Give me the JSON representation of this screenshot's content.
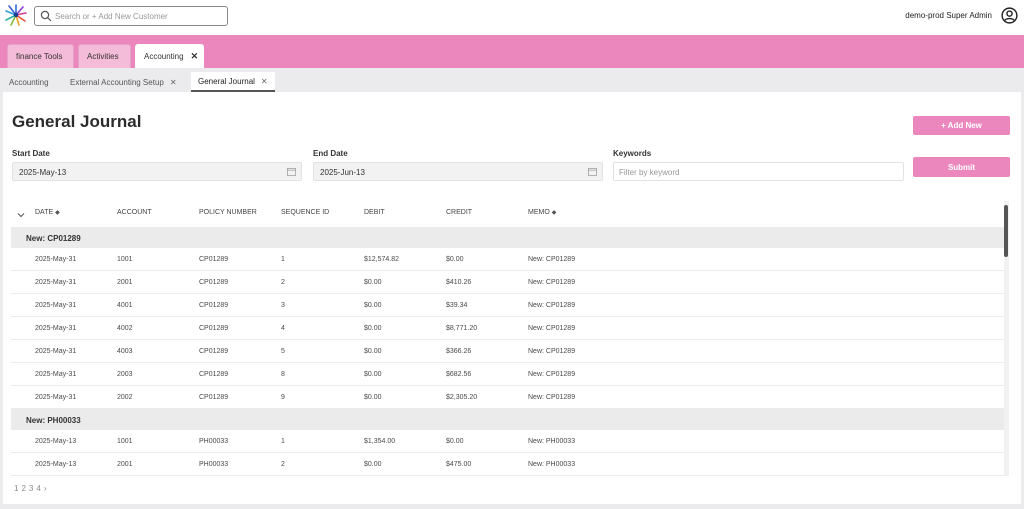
{
  "header": {
    "search_placeholder": "Search or + Add New Customer",
    "user_name": "demo-prod Super Admin"
  },
  "main_tabs": [
    {
      "label": "finance Tools"
    },
    {
      "label": "Activities"
    },
    {
      "label": "Accounting",
      "closable": true,
      "close_glyph": "✕"
    }
  ],
  "sub_tabs": [
    {
      "label": "Accounting"
    },
    {
      "label": "External Accounting Setup",
      "close_glyph": "✕"
    },
    {
      "label": "General Journal",
      "close_glyph": "✕"
    }
  ],
  "page": {
    "title": "General Journal",
    "add_button": "+ Add New",
    "submit_button": "Submit"
  },
  "filters": {
    "start_label": "Start Date",
    "start_value": "2025-May-13",
    "end_label": "End Date",
    "end_value": "2025-Jun-13",
    "keywords_label": "Keywords",
    "keywords_placeholder": "Filter by keyword"
  },
  "table": {
    "sort_glyph": "◆",
    "columns": [
      "DATE",
      "ACCOUNT",
      "POLICY NUMBER",
      "SEQUENCE ID",
      "DEBIT",
      "CREDIT",
      "MEMO"
    ],
    "groups": [
      {
        "label": "New: CP01289",
        "rows": [
          [
            "2025-May-31",
            "1001",
            "CP01289",
            "1",
            "$12,574.82",
            "$0.00",
            "New: CP01289"
          ],
          [
            "2025-May-31",
            "2001",
            "CP01289",
            "2",
            "$0.00",
            "$410.26",
            "New: CP01289"
          ],
          [
            "2025-May-31",
            "4001",
            "CP01289",
            "3",
            "$0.00",
            "$39.34",
            "New: CP01289"
          ],
          [
            "2025-May-31",
            "4002",
            "CP01289",
            "4",
            "$0.00",
            "$8,771.20",
            "New: CP01289"
          ],
          [
            "2025-May-31",
            "4003",
            "CP01289",
            "5",
            "$0.00",
            "$366.26",
            "New: CP01289"
          ],
          [
            "2025-May-31",
            "2003",
            "CP01289",
            "8",
            "$0.00",
            "$682.56",
            "New: CP01289"
          ],
          [
            "2025-May-31",
            "2002",
            "CP01289",
            "9",
            "$0.00",
            "$2,305.20",
            "New: CP01289"
          ]
        ]
      },
      {
        "label": "New: PH00033",
        "rows": [
          [
            "2025-May-13",
            "1001",
            "PH00033",
            "1",
            "$1,354.00",
            "$0.00",
            "New: PH00033"
          ],
          [
            "2025-May-13",
            "2001",
            "PH00033",
            "2",
            "$0.00",
            "$475.00",
            "New: PH00033"
          ]
        ]
      }
    ]
  },
  "pagination": [
    "1",
    "2",
    "3",
    "4",
    "›"
  ],
  "colors": {
    "accent": "#ec87bd",
    "tab_bg": "#f4bcd8",
    "page_bg": "#ebebee"
  }
}
